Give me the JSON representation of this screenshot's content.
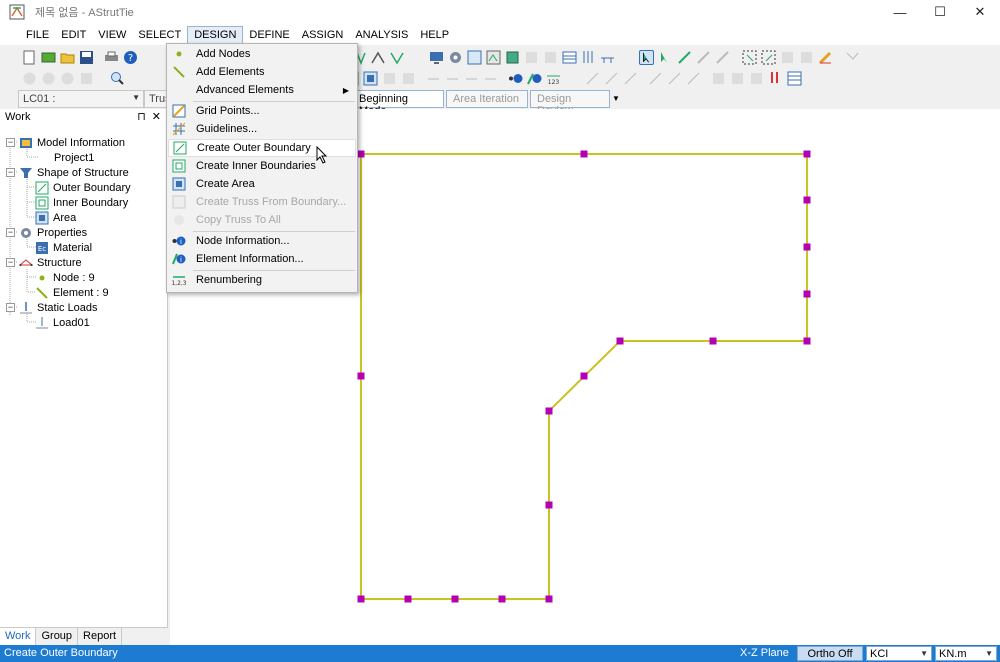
{
  "window": {
    "title": "제목 없음 - AStrutTie",
    "minimize": "—",
    "maximize": "☐",
    "close": "✕"
  },
  "menubar": [
    "FILE",
    "EDIT",
    "VIEW",
    "SELECT",
    "DESIGN",
    "DEFINE",
    "ASSIGN",
    "ANALYSIS",
    "HELP"
  ],
  "active_menu": "DESIGN",
  "combobar": {
    "load_case": "LC01 :",
    "type": "Truss",
    "modes": [
      "Beginning Mode",
      "Area Iteration",
      "Design Review"
    ],
    "active_mode": "Beginning Mode"
  },
  "design_menu": {
    "items": [
      {
        "label": "Add Nodes",
        "icon": "node-dot-icon"
      },
      {
        "label": "Add Elements",
        "icon": "element-line-icon"
      },
      {
        "label": "Advanced Elements",
        "icon": "",
        "submenu": true
      },
      {
        "label": "Grid Points...",
        "icon": "grid-points-icon"
      },
      {
        "label": "Guidelines...",
        "icon": "guidelines-icon"
      },
      {
        "label": "Create Outer Boundary",
        "icon": "outer-boundary-icon"
      },
      {
        "label": "Create Inner Boundaries",
        "icon": "inner-boundary-icon"
      },
      {
        "label": "Create Area",
        "icon": "area-icon"
      },
      {
        "label": "Create Truss From Boundary...",
        "icon": "truss-boundary-icon",
        "disabled": true
      },
      {
        "label": "Copy Truss To All",
        "icon": "copy-truss-icon",
        "disabled": true
      },
      {
        "label": "Node Information...",
        "icon": "node-info-icon"
      },
      {
        "label": "Element Information...",
        "icon": "element-info-icon"
      },
      {
        "label": "Renumbering",
        "icon": "renumber-icon"
      }
    ],
    "hovered": "Create Outer Boundary"
  },
  "work_panel": {
    "title": "Work",
    "pin": "⊓",
    "close": "✕",
    "tree": [
      {
        "label": "Model Information",
        "level": 0
      },
      {
        "label": "Project1",
        "level": 1
      },
      {
        "label": "Shape of Structure",
        "level": 0
      },
      {
        "label": "Outer Boundary",
        "level": 1
      },
      {
        "label": "Inner Boundary",
        "level": 1
      },
      {
        "label": "Area",
        "level": 1
      },
      {
        "label": "Properties",
        "level": 0
      },
      {
        "label": "Material",
        "level": 1
      },
      {
        "label": "Structure",
        "level": 0
      },
      {
        "label": "Node : 9",
        "level": 1
      },
      {
        "label": "Element : 9",
        "level": 1
      },
      {
        "label": "Static Loads",
        "level": 0
      },
      {
        "label": "Load01",
        "level": 1
      }
    ],
    "tabs": [
      "Work",
      "Group",
      "Report"
    ],
    "active_tab": "Work"
  },
  "statusbar": {
    "message": "Create Outer Boundary",
    "plane": "X-Z Plane",
    "ortho": "Ortho Off",
    "code": "KCI",
    "unit": "KN.m"
  },
  "colors": {
    "boundary_line": "#c8c224",
    "node": "#b400b4",
    "statusbar": "#1e7bd2"
  }
}
